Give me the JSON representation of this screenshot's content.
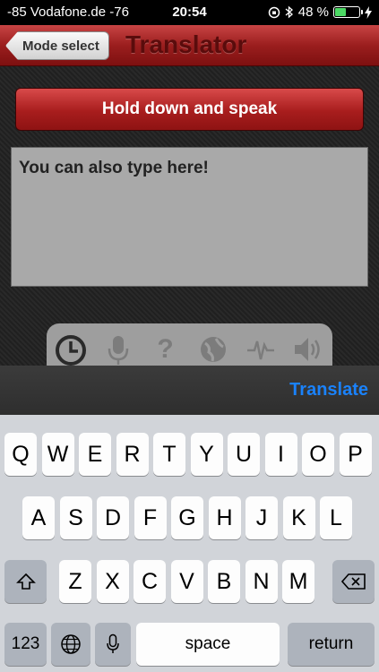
{
  "status_bar": {
    "carrier": "-85 Vodafone.de  -76",
    "time": "20:54",
    "battery": "48 %",
    "battery_level": 0.48
  },
  "nav": {
    "back_label": "Mode select",
    "title": "Translator"
  },
  "main": {
    "speak_label": "Hold down and speak",
    "input_text": "You can also type here!",
    "tools": [
      "clock-icon",
      "microphone-icon",
      "help-icon",
      "globe-icon",
      "waveform-icon",
      "speaker-icon"
    ]
  },
  "accessory": {
    "translate_label": "Translate"
  },
  "keyboard": {
    "row1": [
      "Q",
      "W",
      "E",
      "R",
      "T",
      "Y",
      "U",
      "I",
      "O",
      "P"
    ],
    "row2": [
      "A",
      "S",
      "D",
      "F",
      "G",
      "H",
      "J",
      "K",
      "L"
    ],
    "row3": [
      "Z",
      "X",
      "C",
      "V",
      "B",
      "N",
      "M"
    ],
    "numbers_label": "123",
    "space_label": "space",
    "return_label": "return"
  }
}
